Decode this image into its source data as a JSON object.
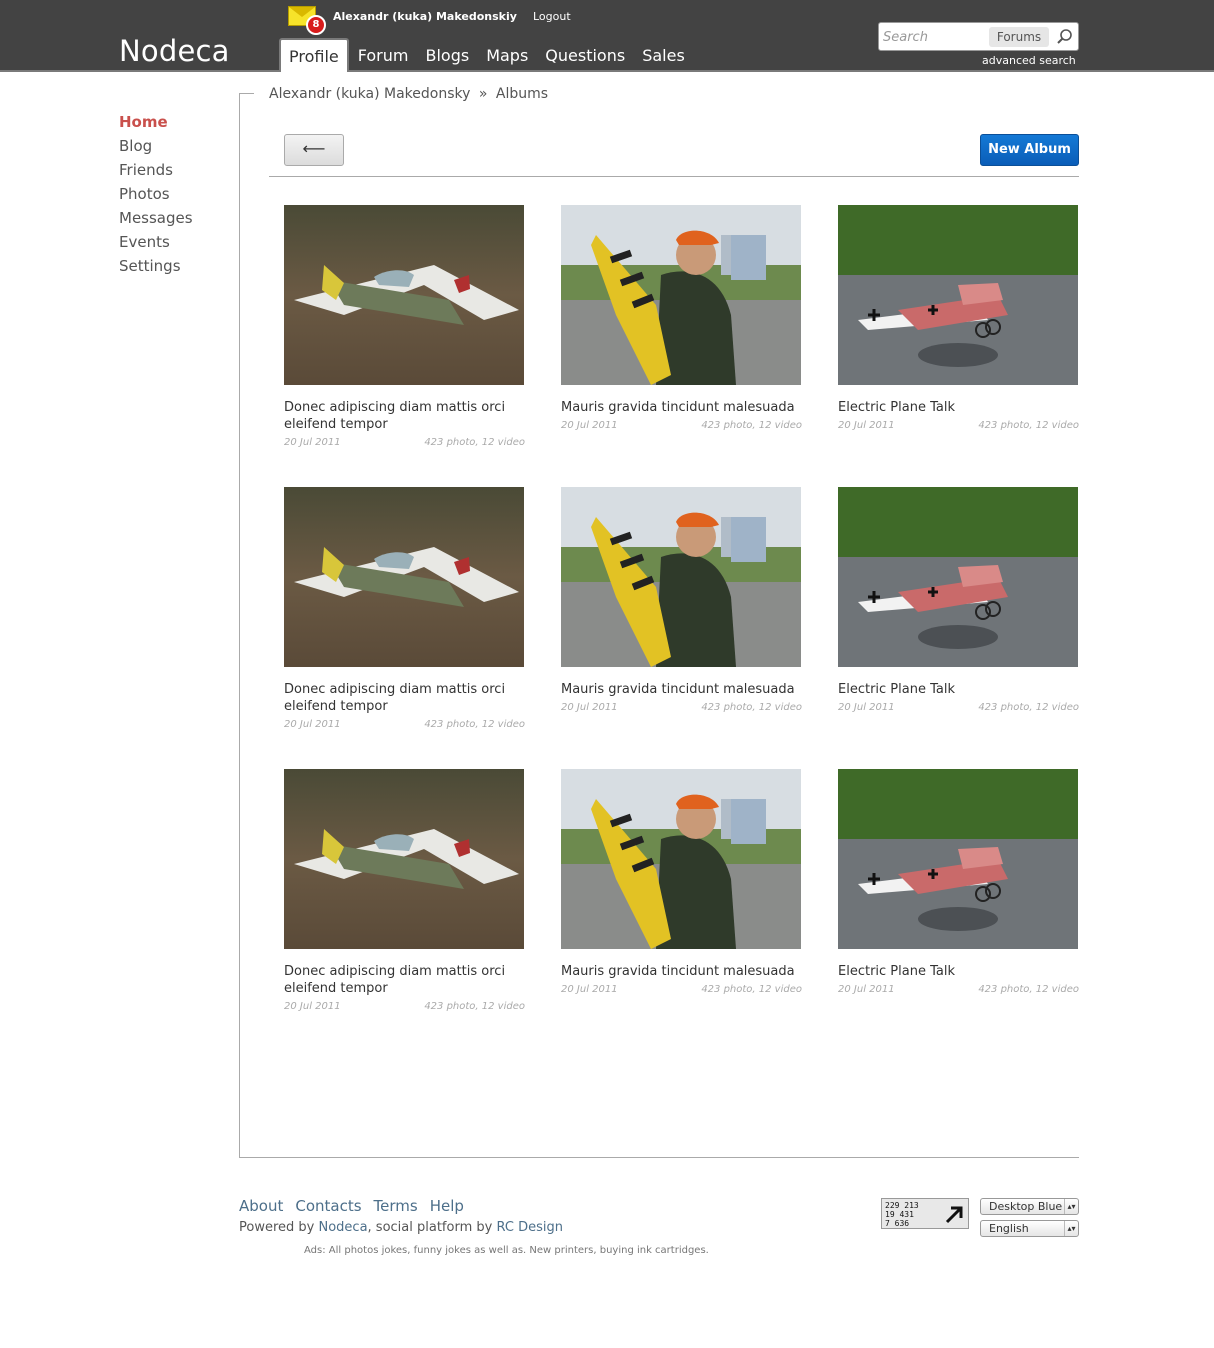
{
  "header": {
    "logo": "Nodeca",
    "notifications_count": "8",
    "username": "Alexandr (kuka) Makedonskiy",
    "logout": "Logout",
    "tabs": [
      "Profile",
      "Forum",
      "Blogs",
      "Maps",
      "Questions",
      "Sales"
    ],
    "active_tab": "Profile",
    "search": {
      "placeholder": "Search",
      "scope": "Forums",
      "advanced": "advanced search"
    }
  },
  "sidenav": {
    "items": [
      "Home",
      "Blog",
      "Friends",
      "Photos",
      "Messages",
      "Events",
      "Settings"
    ],
    "active": "Home"
  },
  "breadcrumb": {
    "user": "Alexandr (kuka) Makedonsky",
    "separator": "»",
    "page": "Albums"
  },
  "toolbar": {
    "back_label": "⟵",
    "new_album": "New Album"
  },
  "albums": [
    {
      "title": "Donec adipiscing diam mattis orci eleifend tempor",
      "date": "20 Jul 2011",
      "counts": "423 photo, 12 video",
      "image": "plane-green"
    },
    {
      "title": "Mauris gravida tincidunt malesuada",
      "date": "20 Jul 2011",
      "counts": "423 photo, 12 video",
      "image": "man-yellow-plane"
    },
    {
      "title": "Electric Plane Talk",
      "date": "20 Jul 2011",
      "counts": "423 photo, 12 video",
      "image": "plane-red"
    },
    {
      "title": "Donec adipiscing diam mattis orci eleifend tempor",
      "date": "20 Jul 2011",
      "counts": "423 photo, 12 video",
      "image": "plane-green"
    },
    {
      "title": "Mauris gravida tincidunt malesuada",
      "date": "20 Jul 2011",
      "counts": "423 photo, 12 video",
      "image": "man-yellow-plane"
    },
    {
      "title": "Electric Plane Talk",
      "date": "20 Jul 2011",
      "counts": "423 photo, 12 video",
      "image": "plane-red"
    },
    {
      "title": "Donec adipiscing diam mattis orci eleifend tempor",
      "date": "20 Jul 2011",
      "counts": "423 photo, 12 video",
      "image": "plane-green"
    },
    {
      "title": "Mauris gravida tincidunt malesuada",
      "date": "20 Jul 2011",
      "counts": "423 photo, 12 video",
      "image": "man-yellow-plane"
    },
    {
      "title": "Electric Plane Talk",
      "date": "20 Jul 2011",
      "counts": "423 photo, 12 video",
      "image": "plane-red"
    }
  ],
  "footer": {
    "links": [
      "About",
      "Contacts",
      "Terms",
      "Help"
    ],
    "powered_prefix": "Powered by",
    "powered_link": "Nodeca",
    "powered_mid": ", social platform by",
    "powered_design": "RC Design",
    "ads": "Ads: All photos jokes, funny jokes as well as. New printers, buying ink cartridges.",
    "counter_lines": [
      "229 213",
      "19 431",
      "7 636"
    ],
    "theme_select": "Desktop Blue",
    "language_select": "English"
  },
  "colors": {
    "topbar": "#434343",
    "accent_active": "#c9504c",
    "link": "#4d6f8a",
    "primary_button": "#0a5db8"
  }
}
